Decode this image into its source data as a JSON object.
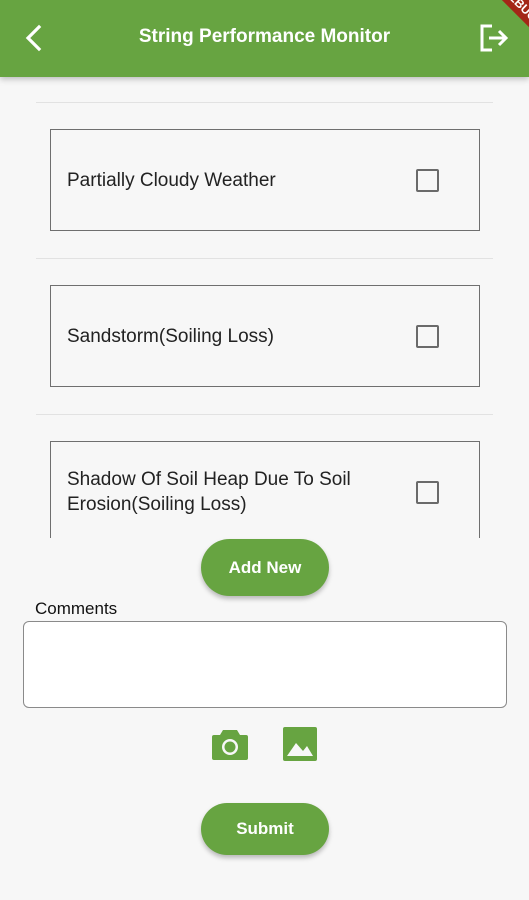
{
  "appbar": {
    "title": "String Performance Monitor",
    "debug_badge": "DEBUG",
    "back_icon": "chevron-left-icon",
    "logout_icon": "logout-icon"
  },
  "issues": [
    {
      "label": "Partially Cloudy Weather",
      "checked": false
    },
    {
      "label": "Sandstorm(Soiling Loss)",
      "checked": false
    },
    {
      "label": "Shadow Of Soil Heap Due To Soil Erosion(Soiling Loss)",
      "checked": false
    }
  ],
  "add_new_label": "Add New",
  "comments": {
    "label": "Comments",
    "value": "",
    "placeholder": ""
  },
  "media": {
    "camera_icon": "camera-icon",
    "gallery_icon": "image-icon"
  },
  "submit_label": "Submit",
  "colors": {
    "primary": "#67a441",
    "debug_ribbon": "#a32617"
  }
}
